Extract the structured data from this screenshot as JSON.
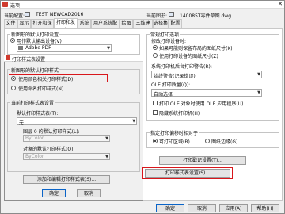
{
  "window": {
    "title": "选项",
    "close_glyph": "✕"
  },
  "profile": {
    "current_config_label": "当前配置:",
    "current_config_value": "TEST_NEWCAD2016",
    "current_drawing_label": "当前图形:",
    "current_drawing_value": "140085T零件草图.dwg"
  },
  "tabs": [
    "文件",
    "显示",
    "打开和保存",
    "打印和发布",
    "系统",
    "用户系统配置",
    "绘图",
    "三维建模",
    "选择集",
    "配置"
  ],
  "left": {
    "new_drawing_group_title": "新图形的默认打印设置",
    "use_as_default_label": "用作默认输出设备(V)",
    "device_value": "Adobe PDF",
    "dialog_title": "打印样式表设置",
    "new_drawing_style_title": "新图形的默认打印样式",
    "radio_color_label": "使用颜色相关打印样式(D)",
    "radio_named_label": "使用命名打印样式(N)",
    "current_table_group_title": "当前打印样式表设置",
    "default_table_label": "默认打印样式表(T):",
    "default_table_value": "无",
    "layer0_label": "图层 0 的默认打印样式(L):",
    "layer0_value": "ByColor",
    "object_label": "对象的默认打印样式(O):",
    "object_value": "ByColor",
    "add_edit_button": "添加和编辑打印样式表(S)..."
  },
  "right": {
    "plot_to_file_title": "常规打印选项",
    "plot_to_file_sub": "修改打印设备时:",
    "keep_paper_label": "如果可能则保留布局的图纸尺寸(K)",
    "use_device_paper_label": "使用打印设备的图纸尺寸(Z)",
    "system_printer_label": "系统打印机后台打印警告(R):",
    "system_printer_value": "始终警告(记录错误)",
    "ole_quality_label": "OLE 打印质量(Q):",
    "ole_quality_value": "自动选择",
    "ole_checkbox_label": "打印 OLE 对象时使用 OLE 应用程序(U)",
    "hide_printer_label": "隐藏系统打印机(H)",
    "offset_group_title": "指定打印偏移时相对于",
    "printable_area_label": "可打印区域(B)",
    "paper_edge_label": "图纸边缘(G)",
    "stamp_button": "打印戳记设置(T)...",
    "style_table_button": "打印样式表设置(S)..."
  },
  "bottom": {
    "ok": "确定",
    "cancel": "取消",
    "apply": "应用(A)",
    "help": "帮助(H)",
    "ok2": "确定"
  }
}
